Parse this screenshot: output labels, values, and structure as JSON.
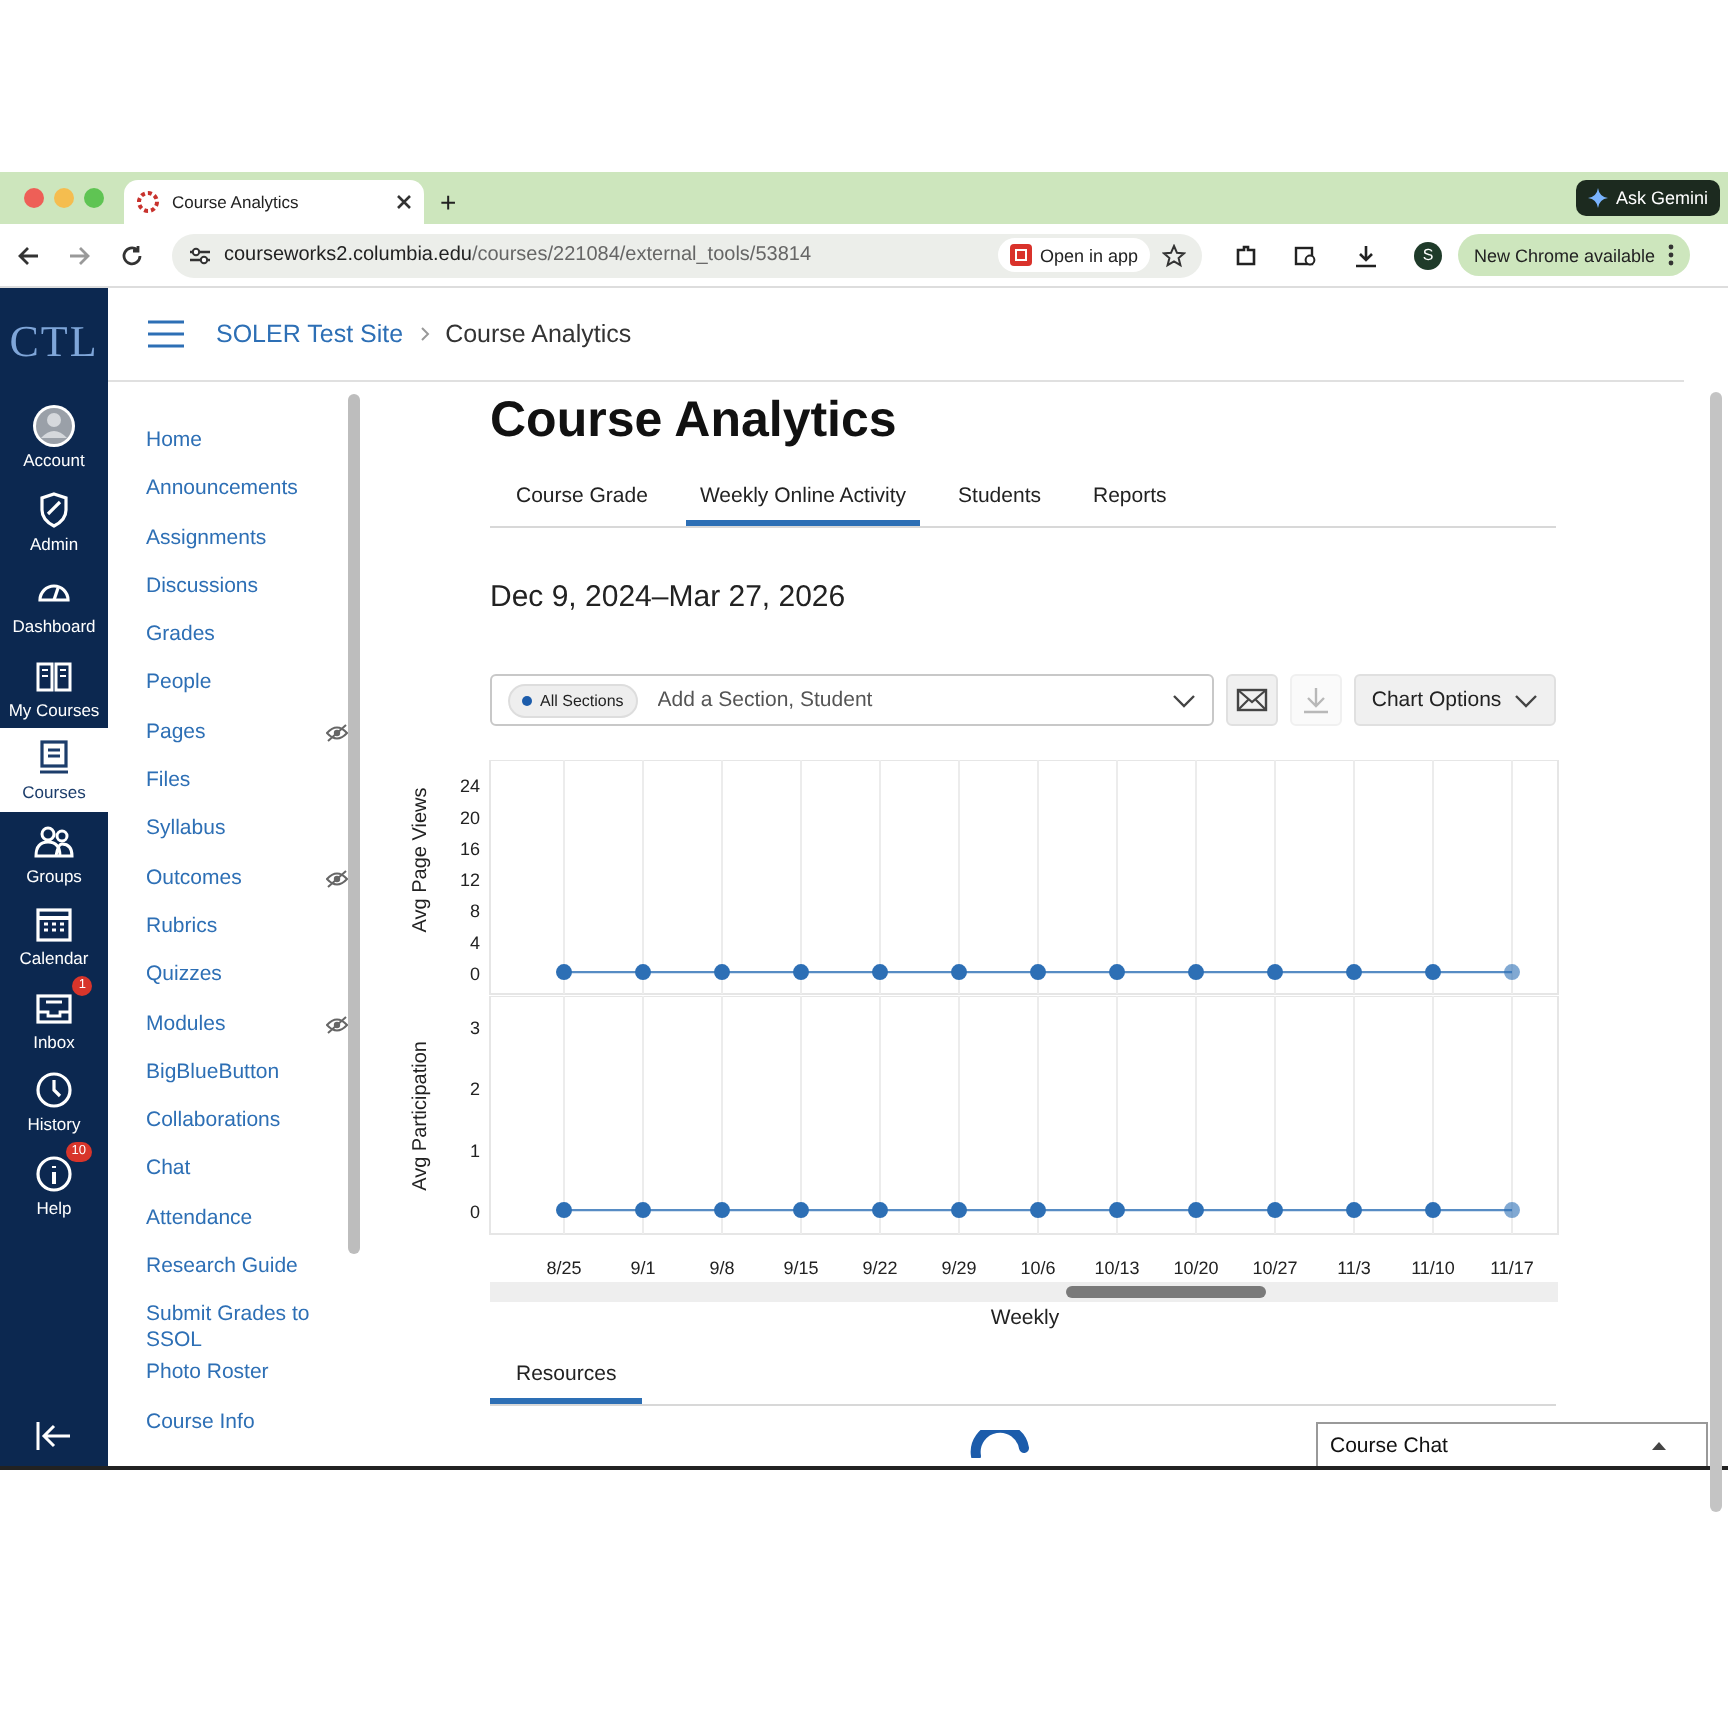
{
  "browser": {
    "tab": {
      "title": "Course Analytics"
    },
    "new_tab": "+",
    "ask_gemini": "Ask Gemini",
    "url": {
      "host": "courseworks2.columbia.edu",
      "path": "/courses/221084/external_tools/53814"
    },
    "open_in_app": "Open in app",
    "profile": "S",
    "update": "New Chrome available"
  },
  "global_nav": {
    "logo": "CTL",
    "items": [
      {
        "label": "Account",
        "selected": false
      },
      {
        "label": "Admin",
        "selected": false
      },
      {
        "label": "Dashboard",
        "selected": false
      },
      {
        "label": "My Courses",
        "selected": false
      },
      {
        "label": "Courses",
        "selected": true
      },
      {
        "label": "Groups",
        "selected": false
      },
      {
        "label": "Calendar",
        "selected": false
      },
      {
        "label": "Inbox",
        "selected": false,
        "badge": "1"
      },
      {
        "label": "History",
        "selected": false
      },
      {
        "label": "Help",
        "selected": false,
        "badge": "10"
      }
    ]
  },
  "breadcrumb": [
    "SOLER Test Site",
    "Course Analytics"
  ],
  "course_nav": [
    {
      "label": "Home",
      "hidden": false
    },
    {
      "label": "Announcements",
      "hidden": false
    },
    {
      "label": "Assignments",
      "hidden": false
    },
    {
      "label": "Discussions",
      "hidden": false
    },
    {
      "label": "Grades",
      "hidden": false
    },
    {
      "label": "People",
      "hidden": false
    },
    {
      "label": "Pages",
      "hidden": true
    },
    {
      "label": "Files",
      "hidden": false
    },
    {
      "label": "Syllabus",
      "hidden": false
    },
    {
      "label": "Outcomes",
      "hidden": true
    },
    {
      "label": "Rubrics",
      "hidden": false
    },
    {
      "label": "Quizzes",
      "hidden": false
    },
    {
      "label": "Modules",
      "hidden": true
    },
    {
      "label": "BigBlueButton",
      "hidden": false
    },
    {
      "label": "Collaborations",
      "hidden": false
    },
    {
      "label": "Chat",
      "hidden": false
    },
    {
      "label": "Attendance",
      "hidden": false
    },
    {
      "label": "Research Guide",
      "hidden": false
    },
    {
      "label": "Submit Grades to SSOL",
      "hidden": false
    },
    {
      "label": "Photo Roster",
      "hidden": false
    },
    {
      "label": "Course Info",
      "hidden": false
    }
  ],
  "page": {
    "title": "Course Analytics",
    "tabs": [
      {
        "label": "Course Grade",
        "selected": false
      },
      {
        "label": "Weekly Online Activity",
        "selected": true
      },
      {
        "label": "Students",
        "selected": false
      },
      {
        "label": "Reports",
        "selected": false
      }
    ],
    "date_range": "Dec 9, 2024–Mar 27, 2026",
    "filter": {
      "chip": "All Sections",
      "placeholder": "Add a Section, Student"
    },
    "toolbar_buttons": [
      {
        "kind": "email",
        "disabled": false
      },
      {
        "kind": "download",
        "disabled": true
      }
    ],
    "chart_options": "Chart Options",
    "charts": [
      {
        "chart_data": {
          "type": "line",
          "ylabel": "Avg Page Views",
          "grid": true,
          "series": [
            {
              "color": "#2d6fb5",
              "marker": true,
              "values": [
                0,
                0,
                0,
                0,
                0,
                0,
                0,
                0,
                0,
                0,
                0,
                0,
                0
              ]
            }
          ],
          "ylim": [
            -2.8,
            27.1
          ],
          "yticks": [
            0,
            4,
            8,
            12,
            16,
            20,
            24
          ]
        }
      },
      {
        "chart_data": {
          "type": "line",
          "xlabel": "Weekly",
          "ylabel": "Avg Participation",
          "grid": true,
          "categories": [
            "8/25",
            "9/1",
            "9/8",
            "9/15",
            "9/22",
            "9/29",
            "10/6",
            "10/13",
            "10/20",
            "10/27",
            "11/3",
            "11/10",
            "11/17"
          ],
          "series": [
            {
              "color": "#2d6fb5",
              "marker": true,
              "values": [
                0,
                0,
                0,
                0,
                0,
                0,
                0,
                0,
                0,
                0,
                0,
                0,
                0
              ]
            }
          ],
          "ylim": [
            -0.39,
            3.49
          ],
          "yticks": [
            0,
            1,
            2,
            3
          ]
        }
      }
    ],
    "bottom_tabs": [
      {
        "label": "Resources",
        "selected": true
      }
    ],
    "course_chat": "Course Chat"
  }
}
